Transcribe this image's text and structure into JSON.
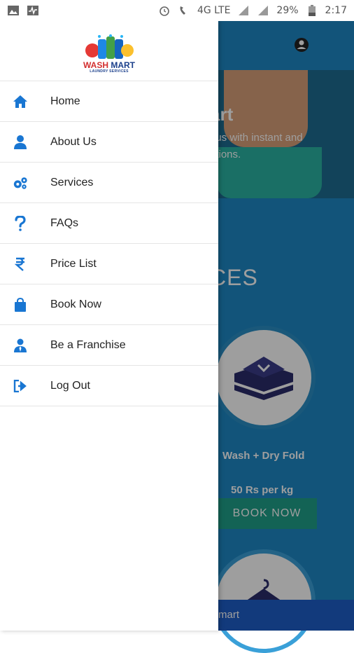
{
  "status_bar": {
    "battery": "29%",
    "time": "2:17",
    "network": "4G LTE"
  },
  "app": {
    "hero": {
      "title_fragment": "art",
      "line1": "ous with instant and",
      "line2": "utions."
    },
    "services_heading": "CES",
    "service": {
      "name": "Wash + Dry Fold",
      "price": "50 Rs per kg",
      "book_label": "BOOK NOW"
    },
    "bottom_bar_text": "mart"
  },
  "drawer": {
    "logo": {
      "title_wash": "WASH",
      "title_mart": "MART",
      "subtitle": "LAUNDRY SERVICES"
    },
    "menu": [
      {
        "label": "Home",
        "icon": "home-icon"
      },
      {
        "label": "About Us",
        "icon": "user-icon"
      },
      {
        "label": "Services",
        "icon": "gears-icon"
      },
      {
        "label": "FAQs",
        "icon": "question-icon"
      },
      {
        "label": "Price List",
        "icon": "rupee-icon"
      },
      {
        "label": "Book Now",
        "icon": "shopping-bag-icon"
      },
      {
        "label": "Be a Franchise",
        "icon": "user-tie-icon"
      },
      {
        "label": "Log Out",
        "icon": "sign-out-icon"
      }
    ]
  },
  "colors": {
    "accent": "#1976d2",
    "app_blue": "#1e88c6",
    "book_button": "#1fa08a"
  }
}
